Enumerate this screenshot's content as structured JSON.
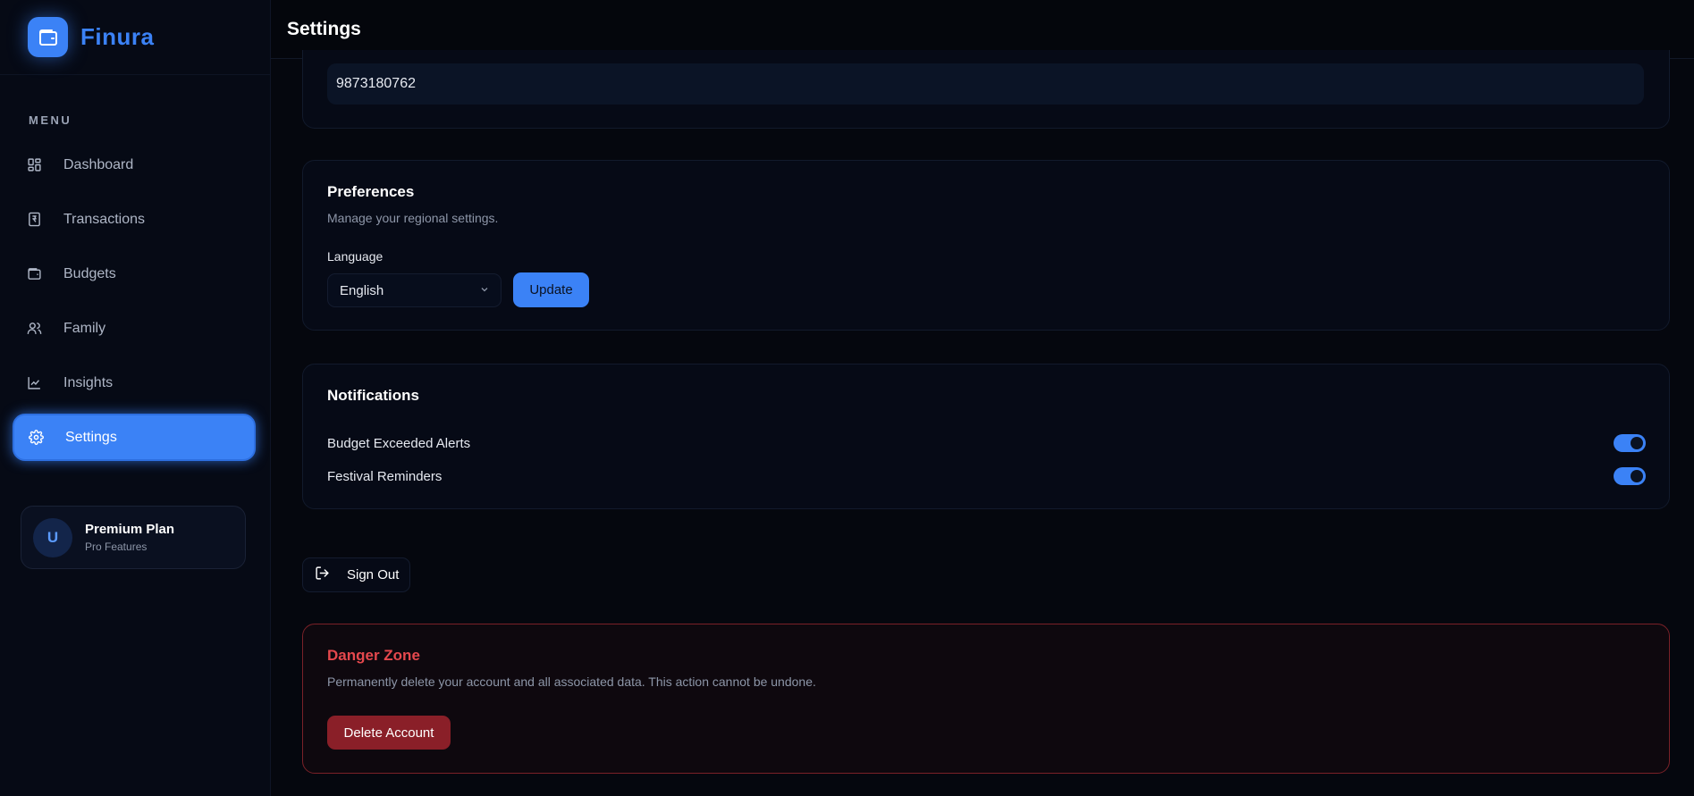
{
  "brand": {
    "name": "Finura",
    "logo_icon": "wallet-icon"
  },
  "sidebar": {
    "menu_label": "MENU",
    "items": [
      {
        "label": "Dashboard",
        "icon": "grid-icon",
        "active": false
      },
      {
        "label": "Transactions",
        "icon": "receipt-icon",
        "active": false
      },
      {
        "label": "Budgets",
        "icon": "wallet-icon",
        "active": false
      },
      {
        "label": "Family",
        "icon": "users-icon",
        "active": false
      },
      {
        "label": "Insights",
        "icon": "chart-line-icon",
        "active": false
      },
      {
        "label": "Settings",
        "icon": "gear-icon",
        "active": true
      }
    ],
    "plan": {
      "avatar": "U",
      "title": "Premium Plan",
      "subtitle": "Pro Features"
    }
  },
  "header": {
    "title": "Settings"
  },
  "profile": {
    "phone_value": "9873180762"
  },
  "preferences": {
    "title": "Preferences",
    "description": "Manage your regional settings.",
    "language_label": "Language",
    "language_value": "English",
    "update_label": "Update"
  },
  "notifications": {
    "title": "Notifications",
    "items": [
      {
        "label": "Budget Exceeded Alerts",
        "enabled": true
      },
      {
        "label": "Festival Reminders",
        "enabled": true
      }
    ]
  },
  "signout": {
    "label": "Sign Out",
    "icon": "sign-out-icon"
  },
  "danger": {
    "title": "Danger Zone",
    "description": "Permanently delete your account and all associated data. This action cannot be undone.",
    "delete_label": "Delete Account"
  },
  "colors": {
    "accent": "#3b82f6",
    "danger": "#e5484d",
    "danger_button": "#8a1f28",
    "background": "#05070e"
  }
}
